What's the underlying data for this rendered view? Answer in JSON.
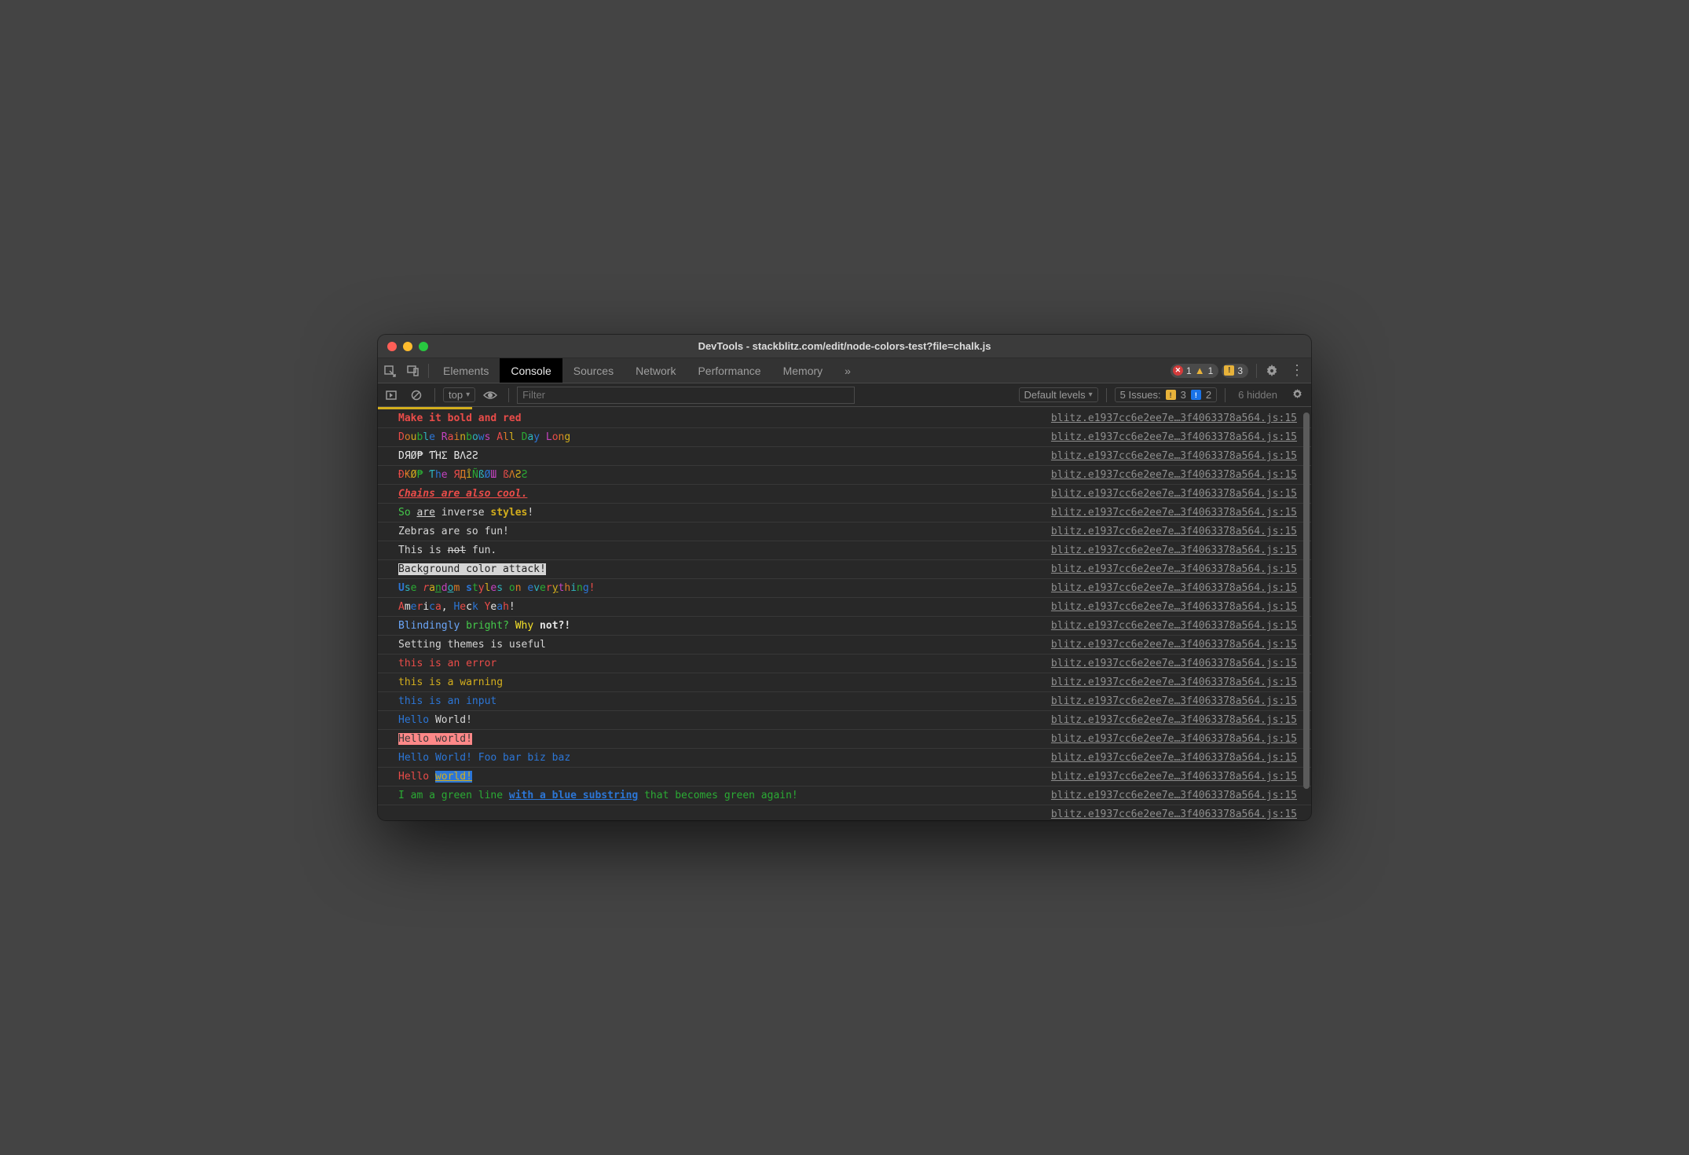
{
  "window": {
    "title": "DevTools - stackblitz.com/edit/node-colors-test?file=chalk.js"
  },
  "tabs": [
    "Elements",
    "Console",
    "Sources",
    "Network",
    "Performance",
    "Memory"
  ],
  "activeTab": "Console",
  "overflow": "»",
  "badges": {
    "errors": "1",
    "warnings": "1",
    "issues": "3"
  },
  "filterbar": {
    "context": "top",
    "filterPlaceholder": "Filter",
    "levels": "Default levels",
    "issuesLabel": "5 Issues:",
    "issW": "3",
    "issB": "2",
    "hidden": "6 hidden"
  },
  "src": "blitz.e1937cc6e2ee7e…3f4063378a564.js:15",
  "rows": {
    "r1": {
      "segs": [
        {
          "t": "Make it bold and red",
          "cls": "b c-red"
        }
      ]
    },
    "r2": {
      "segs": [
        {
          "t": "D",
          "cls": "c-red"
        },
        {
          "t": "o",
          "cls": "c-orange"
        },
        {
          "t": "u",
          "cls": "c-yellow"
        },
        {
          "t": "b",
          "cls": "c-green"
        },
        {
          "t": "l",
          "cls": "c-cyan"
        },
        {
          "t": "e",
          "cls": "c-blue"
        },
        {
          "t": " ",
          "cls": ""
        },
        {
          "t": "R",
          "cls": "c-magenta"
        },
        {
          "t": "a",
          "cls": "c-red"
        },
        {
          "t": "i",
          "cls": "c-orange"
        },
        {
          "t": "n",
          "cls": "c-yellow"
        },
        {
          "t": "b",
          "cls": "c-green"
        },
        {
          "t": "o",
          "cls": "c-cyan"
        },
        {
          "t": "w",
          "cls": "c-blue"
        },
        {
          "t": "s",
          "cls": "c-magenta"
        },
        {
          "t": " ",
          "cls": ""
        },
        {
          "t": "A",
          "cls": "c-red"
        },
        {
          "t": "l",
          "cls": "c-orange"
        },
        {
          "t": "l",
          "cls": "c-yellow"
        },
        {
          "t": " ",
          "cls": ""
        },
        {
          "t": "D",
          "cls": "c-green"
        },
        {
          "t": "a",
          "cls": "c-cyan"
        },
        {
          "t": "y",
          "cls": "c-blue"
        },
        {
          "t": " ",
          "cls": ""
        },
        {
          "t": "L",
          "cls": "c-magenta"
        },
        {
          "t": "o",
          "cls": "c-red"
        },
        {
          "t": "n",
          "cls": "c-orange"
        },
        {
          "t": "g",
          "cls": "c-yellow"
        }
      ]
    },
    "r3": {
      "segs": [
        {
          "t": "DЯØ₱ ƬΉΣ BΛƧƧ",
          "cls": "c-white"
        }
      ]
    },
    "r4": {
      "segs": [
        {
          "t": "Ð",
          "cls": "c-red"
        },
        {
          "t": "₭",
          "cls": "c-orange"
        },
        {
          "t": "Ø",
          "cls": "c-yellow"
        },
        {
          "t": "₱",
          "cls": "c-green"
        },
        {
          "t": " ",
          "cls": ""
        },
        {
          "t": "Ƭ",
          "cls": "c-cyan"
        },
        {
          "t": "h",
          "cls": "c-blue"
        },
        {
          "t": "e",
          "cls": "c-magenta"
        },
        {
          "t": " ",
          "cls": ""
        },
        {
          "t": "Я",
          "cls": "c-red"
        },
        {
          "t": "Д",
          "cls": "c-orange"
        },
        {
          "t": "i̊",
          "cls": "c-yellow"
        },
        {
          "t": "Ñ",
          "cls": "c-green"
        },
        {
          "t": "ß",
          "cls": "c-cyan"
        },
        {
          "t": "Ø",
          "cls": "c-blue"
        },
        {
          "t": "Ш",
          "cls": "c-magenta"
        },
        {
          "t": " ",
          "cls": ""
        },
        {
          "t": "ß",
          "cls": "c-red"
        },
        {
          "t": "Λ",
          "cls": "c-orange"
        },
        {
          "t": "Ƨ",
          "cls": "c-yellow"
        },
        {
          "t": "Ƨ",
          "cls": "c-green"
        }
      ]
    },
    "r5": {
      "segs": [
        {
          "t": "Chains are also cool.",
          "cls": "b i u c-red"
        }
      ]
    },
    "r6": {
      "segs": [
        {
          "t": "So",
          "cls": "c-lgreen"
        },
        {
          "t": " ",
          "cls": ""
        },
        {
          "t": "are",
          "cls": "u"
        },
        {
          "t": " inverse ",
          "cls": ""
        },
        {
          "t": "styles",
          "cls": "b c-yellow"
        },
        {
          "t": "!",
          "cls": ""
        }
      ]
    },
    "r7": {
      "segs": [
        {
          "t": "Zebras are so fun!",
          "cls": ""
        }
      ]
    },
    "r8": {
      "segs": [
        {
          "t": "This is ",
          "cls": ""
        },
        {
          "t": "not",
          "cls": "s"
        },
        {
          "t": " fun.",
          "cls": ""
        }
      ]
    },
    "r9": {
      "segs": [
        {
          "t": "Background color attack!",
          "cls": "bg-white"
        }
      ]
    },
    "r10": {
      "segs": [
        {
          "t": "U",
          "cls": "b c-blue"
        },
        {
          "t": "s",
          "cls": "c-cyan"
        },
        {
          "t": "e",
          "cls": "c-green"
        },
        {
          "t": " ",
          "cls": ""
        },
        {
          "t": "r",
          "cls": "i c-red"
        },
        {
          "t": "a",
          "cls": "c-yellow"
        },
        {
          "t": "n",
          "cls": "u c-green"
        },
        {
          "t": "d",
          "cls": "c-magenta"
        },
        {
          "t": "o",
          "cls": "u c-cyan"
        },
        {
          "t": "m",
          "cls": "c-orange"
        },
        {
          "t": " ",
          "cls": ""
        },
        {
          "t": "s",
          "cls": "b c-blue"
        },
        {
          "t": "t",
          "cls": "c-green"
        },
        {
          "t": "y",
          "cls": "c-red"
        },
        {
          "t": "l",
          "cls": "c-yellow"
        },
        {
          "t": "e",
          "cls": "c-magenta"
        },
        {
          "t": "s",
          "cls": "c-cyan"
        },
        {
          "t": " ",
          "cls": ""
        },
        {
          "t": "o",
          "cls": "c-green"
        },
        {
          "t": "n",
          "cls": "c-orange"
        },
        {
          "t": " ",
          "cls": ""
        },
        {
          "t": "e",
          "cls": "c-blue"
        },
        {
          "t": "v",
          "cls": "c-cyan"
        },
        {
          "t": "e",
          "cls": "c-green"
        },
        {
          "t": "r",
          "cls": "c-red"
        },
        {
          "t": "y",
          "cls": "u c-yellow"
        },
        {
          "t": "t",
          "cls": "c-magenta"
        },
        {
          "t": "h",
          "cls": "c-orange"
        },
        {
          "t": "i",
          "cls": "c-cyan"
        },
        {
          "t": "n",
          "cls": "c-green"
        },
        {
          "t": "g",
          "cls": "c-blue"
        },
        {
          "t": "!",
          "cls": "c-red"
        }
      ]
    },
    "r11": {
      "segs": [
        {
          "t": "A",
          "cls": "c-red"
        },
        {
          "t": "m",
          "cls": "c-white"
        },
        {
          "t": "e",
          "cls": "c-blue"
        },
        {
          "t": "r",
          "cls": "c-red"
        },
        {
          "t": "i",
          "cls": "c-white"
        },
        {
          "t": "c",
          "cls": "c-blue"
        },
        {
          "t": "a",
          "cls": "c-red"
        },
        {
          "t": ",",
          "cls": "c-white"
        },
        {
          "t": " ",
          "cls": ""
        },
        {
          "t": "H",
          "cls": "c-blue"
        },
        {
          "t": "e",
          "cls": "c-red"
        },
        {
          "t": "c",
          "cls": "c-white"
        },
        {
          "t": "k",
          "cls": "c-blue"
        },
        {
          "t": " ",
          "cls": ""
        },
        {
          "t": "Y",
          "cls": "c-red"
        },
        {
          "t": "e",
          "cls": "c-white"
        },
        {
          "t": "a",
          "cls": "c-blue"
        },
        {
          "t": "h",
          "cls": "c-red"
        },
        {
          "t": "!",
          "cls": "c-white"
        }
      ]
    },
    "r12": {
      "segs": [
        {
          "t": "Blindingly",
          "cls": "c-lblue"
        },
        {
          "t": " ",
          "cls": ""
        },
        {
          "t": "bright?",
          "cls": "c-lgreen"
        },
        {
          "t": " ",
          "cls": ""
        },
        {
          "t": "Why",
          "cls": "c-byellow"
        },
        {
          "t": " ",
          "cls": ""
        },
        {
          "t": "not?!",
          "cls": "c-white b"
        }
      ]
    },
    "r13": {
      "segs": [
        {
          "t": "Setting themes is useful",
          "cls": ""
        }
      ]
    },
    "r14": {
      "segs": [
        {
          "t": "this is an error",
          "cls": "c-red"
        }
      ]
    },
    "r15": {
      "segs": [
        {
          "t": "this is a warning",
          "cls": "c-yellow"
        }
      ]
    },
    "r16": {
      "segs": [
        {
          "t": "this is an input",
          "cls": "c-blue"
        }
      ]
    },
    "r17": {
      "segs": [
        {
          "t": "Hello",
          "cls": "c-blue"
        },
        {
          "t": " World!",
          "cls": ""
        }
      ]
    },
    "r18": {
      "segs": [
        {
          "t": "Hello world!",
          "cls": "bg-lightred hb"
        }
      ]
    },
    "r19": {
      "segs": [
        {
          "t": "Hello World! Foo bar biz baz",
          "cls": "c-blue"
        }
      ]
    },
    "r20": {
      "segs": [
        {
          "t": "Hello",
          "cls": "c-red"
        },
        {
          "t": " ",
          "cls": ""
        },
        {
          "t": "world!",
          "cls": "bg-blue c-yellow u"
        }
      ]
    },
    "r21": {
      "segs": [
        {
          "t": "I am a green line ",
          "cls": "c-green"
        },
        {
          "t": "with a blue substring",
          "cls": "b u c-blue"
        },
        {
          "t": " that becomes green again!",
          "cls": "c-green"
        }
      ]
    },
    "r22": {
      "segs": [
        {
          "t": "",
          "cls": ""
        }
      ]
    }
  }
}
